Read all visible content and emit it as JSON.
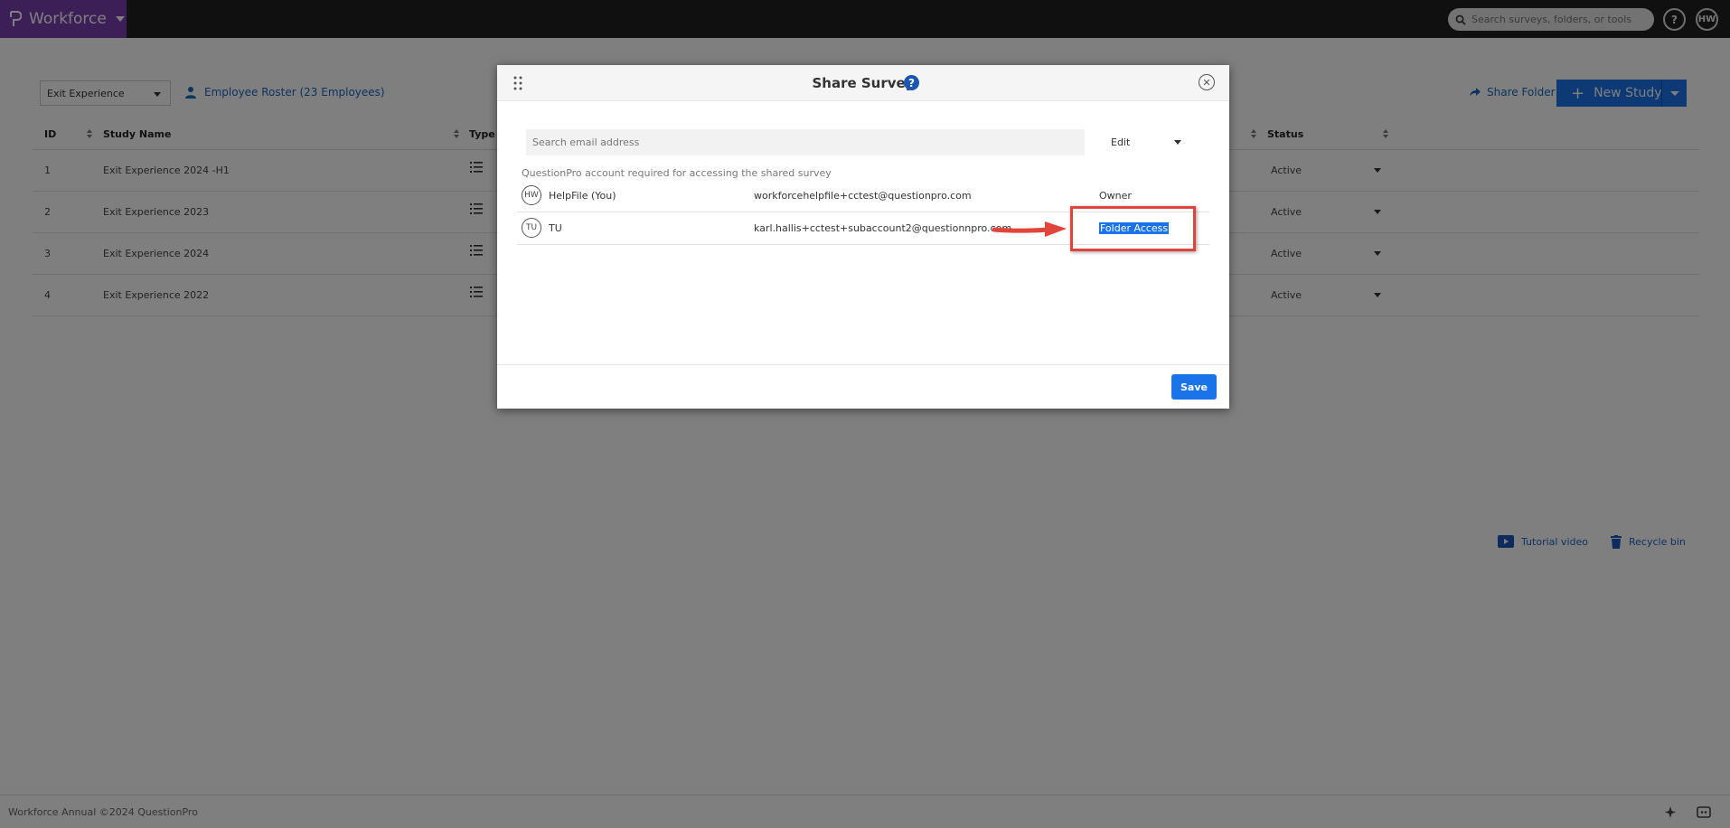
{
  "app": {
    "name": "Workforce",
    "search_placeholder": "Search surveys, folders, or tools",
    "help_label": "?",
    "user_initials": "HW"
  },
  "toolbar": {
    "folder": "Exit Experience",
    "roster_link": "Employee Roster (23 Employees)",
    "share_folder": "Share Folder",
    "new_study": "New Study"
  },
  "table": {
    "columns": [
      "ID",
      "Study Name",
      "Type",
      "Status"
    ],
    "rows": [
      {
        "id": "1",
        "name": "Exit Experience 2024 -H1",
        "status": "Active"
      },
      {
        "id": "2",
        "name": "Exit Experience 2023",
        "status": "Active"
      },
      {
        "id": "3",
        "name": "Exit Experience 2024",
        "status": "Active"
      },
      {
        "id": "4",
        "name": "Exit Experience 2022",
        "status": "Active"
      }
    ]
  },
  "links": {
    "tutorial": "Tutorial video",
    "recycle": "Recycle bin"
  },
  "footer": {
    "copyright": "Workforce Annual ©2024 QuestionPro"
  },
  "modal": {
    "title": "Share Survey",
    "help": "?",
    "email_placeholder": "Search email address",
    "permission": "Edit",
    "note": "QuestionPro account required for accessing the shared survey",
    "shares": [
      {
        "initials": "HW",
        "name": "HelpFile (You)",
        "email": "workforcehelpfile+cctest@questionpro.com",
        "role": "Owner"
      },
      {
        "initials": "TU",
        "name": "TU",
        "email": "karl.hallis+cctest+subaccount2@questionnpro.com",
        "role": "Folder Access"
      }
    ],
    "save": "Save"
  },
  "colors": {
    "brand": "#7b3fb0",
    "primary": "#1a73e8",
    "callout": "#e0443a",
    "topbar": "#212121"
  }
}
